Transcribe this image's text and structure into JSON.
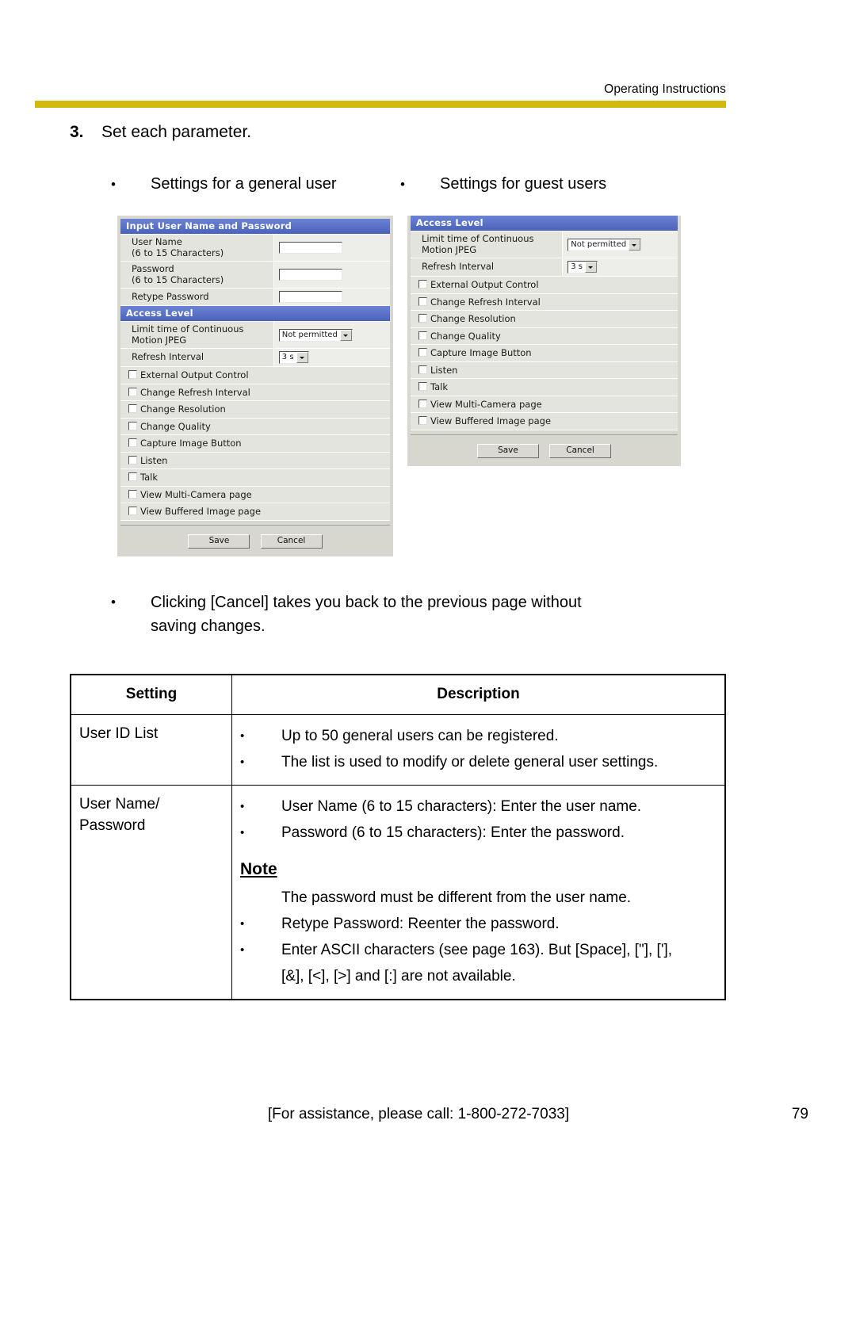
{
  "header": {
    "title": "Operating Instructions",
    "rule_color": "#d4b80c"
  },
  "step": {
    "number": "3.",
    "text": "Set each parameter."
  },
  "captions": {
    "bullet": "•",
    "left": "Settings for a general user",
    "right": "Settings for guest users"
  },
  "screenshot_left": {
    "section_user": "Input User Name and Password",
    "section_access": "Access Level",
    "fields": [
      {
        "label_line1": "User Name",
        "label_line2": "(6 to 15 Characters)",
        "value": ""
      },
      {
        "label_line1": "Password",
        "label_line2": "(6 to 15 Characters)",
        "value": ""
      },
      {
        "label_line1": "Retype Password",
        "label_line2": "",
        "value": ""
      }
    ],
    "limit_label_line1": "Limit time of Continuous",
    "limit_label_line2": "Motion JPEG",
    "limit_value": "Not permitted",
    "refresh_label": "Refresh Interval",
    "refresh_value": "3 s",
    "checkboxes": [
      "External Output Control",
      "Change Refresh Interval",
      "Change Resolution",
      "Change Quality",
      "Capture Image Button",
      "Listen",
      "Talk",
      "View Multi-Camera page",
      "View Buffered Image page"
    ],
    "save_label": "Save",
    "cancel_label": "Cancel"
  },
  "screenshot_right": {
    "section_access": "Access Level",
    "limit_label_line1": "Limit time of Continuous",
    "limit_label_line2": "Motion JPEG",
    "limit_value": "Not permitted",
    "refresh_label": "Refresh Interval",
    "refresh_value": "3 s",
    "checkboxes": [
      "External Output Control",
      "Change Refresh Interval",
      "Change Resolution",
      "Change Quality",
      "Capture Image Button",
      "Listen",
      "Talk",
      "View Multi-Camera page",
      "View Buffered Image page"
    ],
    "save_label": "Save",
    "cancel_label": "Cancel"
  },
  "cancel_note": {
    "bullet": "•",
    "line1": "Clicking [Cancel] takes you back to the previous page without",
    "line2": "saving changes."
  },
  "table": {
    "headers": {
      "setting": "Setting",
      "description": "Description"
    },
    "bullet": "•",
    "rows": [
      {
        "setting": "User ID List",
        "bullets": [
          "Up to 50 general users can be registered.",
          "The list is used to modify or delete general user settings."
        ]
      },
      {
        "setting_line1": "User Name/",
        "setting_line2": "Password",
        "bullets_top": [
          "User Name (6 to 15 characters): Enter the user name.",
          "Password (6 to 15 characters): Enter the password."
        ],
        "note_heading": "Note",
        "note_text": "The password must be different from the user name.",
        "bullets_bottom": [
          "Retype Password: Reenter the password.",
          "Enter ASCII characters (see page 163). But [Space], [\"], ['],"
        ],
        "bullets_bottom_cont": "[&], [<], [>] and [:] are not available."
      }
    ]
  },
  "footer": {
    "assistance": "[For assistance, please call: 1-800-272-7033]",
    "page_number": "79"
  }
}
